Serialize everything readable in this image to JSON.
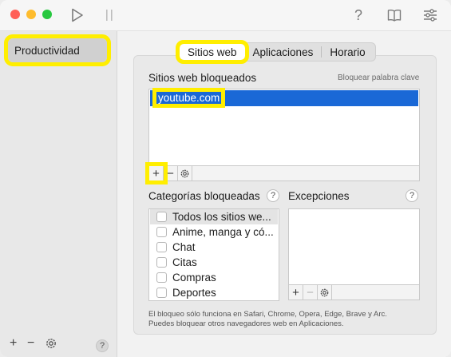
{
  "toolbar": {
    "play_icon": "play-icon",
    "pause_icon": "pause-icon",
    "help_label": "?",
    "book_icon": "book-icon",
    "settings_icon": "sliders-icon"
  },
  "sidebar": {
    "items": [
      {
        "label": "Productividad",
        "selected": true
      }
    ],
    "footer": {
      "add_label": "+",
      "remove_label": "−",
      "help_label": "?"
    }
  },
  "tabs": [
    {
      "label": "Sitios web",
      "active": true
    },
    {
      "label": "Aplicaciones"
    },
    {
      "label": "Horario"
    }
  ],
  "blocked_sites": {
    "title": "Sitios web bloqueados",
    "keyword_link": "Bloquear palabra clave",
    "items": [
      "youtube.com"
    ],
    "add_label": "+",
    "remove_label": "−"
  },
  "categories": {
    "title": "Categorías bloqueadas",
    "help_label": "?",
    "items": [
      "Todos los sitios we...",
      "Anime, manga y có...",
      "Chat",
      "Citas",
      "Compras",
      "Deportes"
    ]
  },
  "exceptions": {
    "title": "Excepciones",
    "help_label": "?",
    "add_label": "+",
    "remove_label": "−"
  },
  "note": {
    "line1": "El bloqueo sólo funciona en Safari, Chrome, Opera, Edge, Brave y Arc.",
    "line2": "Puedes bloquear otros navegadores web en Aplicaciones."
  },
  "colors": {
    "selection": "#1a68d6",
    "highlight": "#ffee00"
  }
}
